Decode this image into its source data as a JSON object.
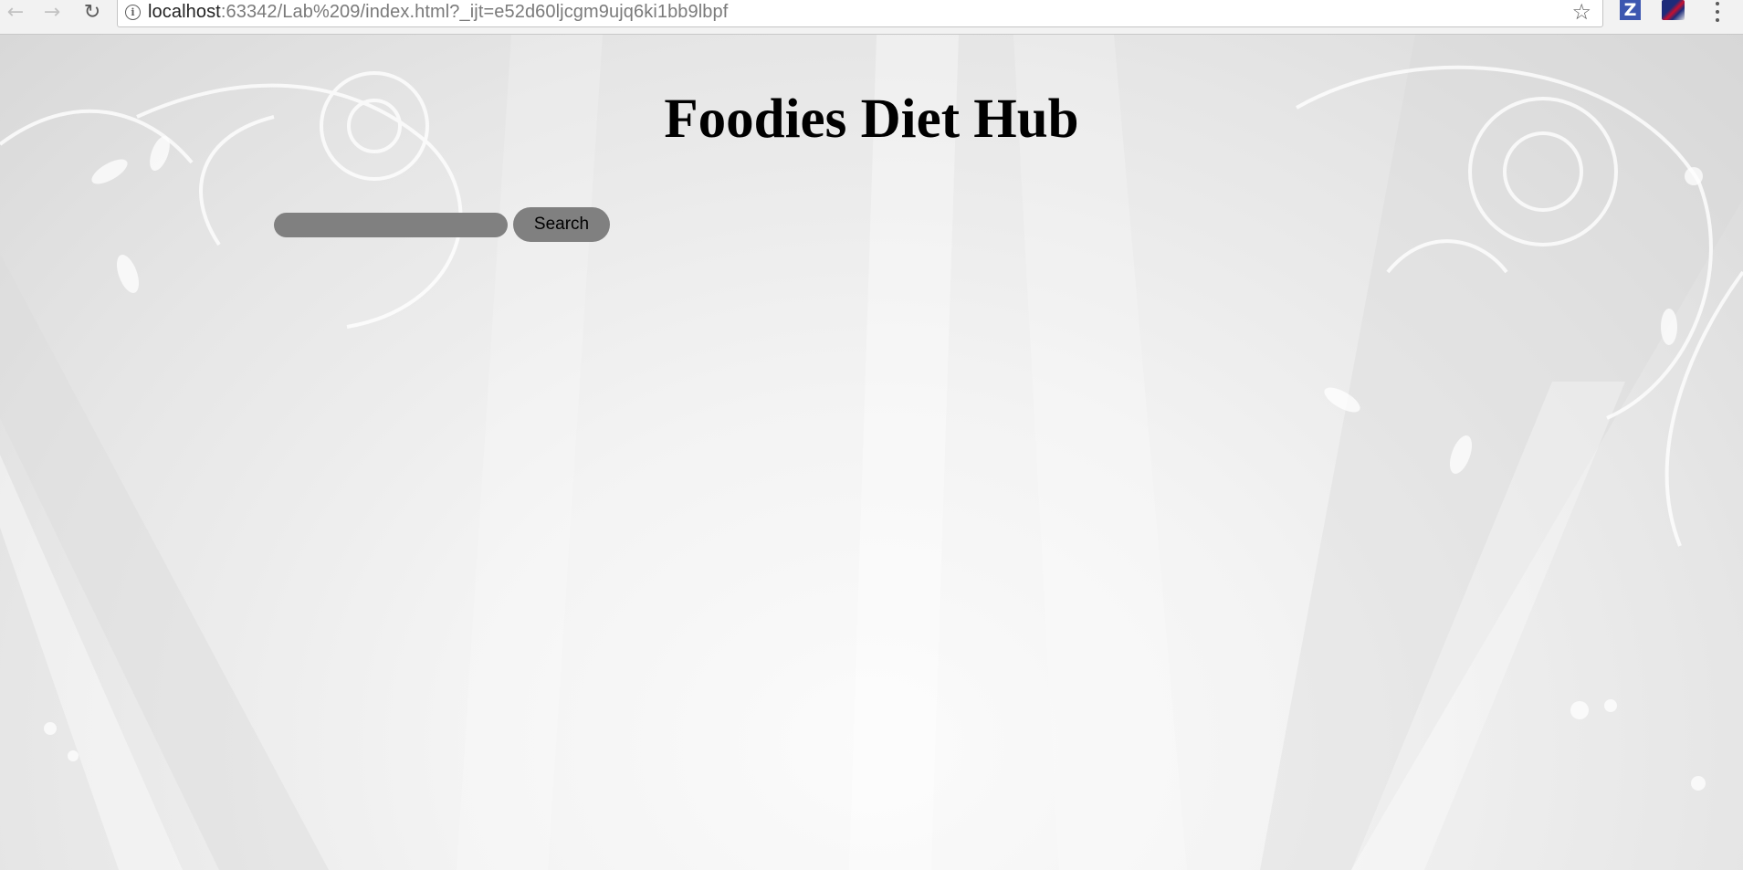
{
  "browser": {
    "url_host": "localhost",
    "url_rest": ":63342/Lab%209/index.html?_ijt=e52d60ljcgm9ujq6ki1bb9lbpf",
    "icons": [
      "back-arrow-icon",
      "forward-arrow-icon",
      "reload-icon",
      "info-icon",
      "star-icon",
      "z-extension-icon",
      "flag-extension-icon",
      "menu-dots-icon"
    ]
  },
  "page": {
    "title": "Foodies Diet Hub",
    "search": {
      "input_value": "",
      "button_label": "Search"
    }
  },
  "colors": {
    "input_bg": "#808080",
    "button_bg": "#808080",
    "title_color": "#000000",
    "background": "#eeeeee"
  }
}
